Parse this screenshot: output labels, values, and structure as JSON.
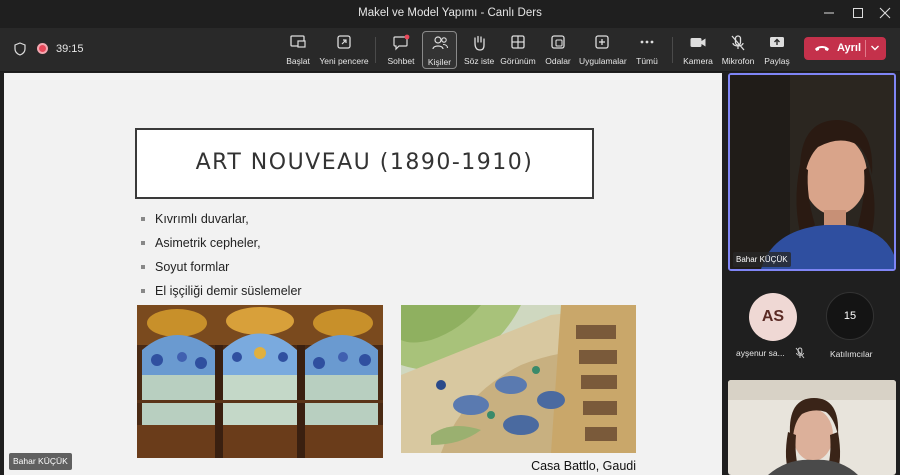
{
  "window": {
    "title": "Makel ve Model Yapımı - Canlı Ders"
  },
  "toolbar": {
    "timer": "39:15",
    "buttons": [
      {
        "label": "Başlat",
        "icon": "share-screen-icon"
      },
      {
        "label": "Yeni pencere",
        "icon": "new-window-icon"
      },
      {
        "label": "Sohbet",
        "icon": "chat-icon"
      },
      {
        "label": "Kişiler",
        "icon": "people-icon"
      },
      {
        "label": "Söz iste",
        "icon": "raise-hand-icon"
      },
      {
        "label": "Görünüm",
        "icon": "view-icon"
      },
      {
        "label": "Odalar",
        "icon": "rooms-icon"
      },
      {
        "label": "Uygulamalar",
        "icon": "apps-icon"
      },
      {
        "label": "Tümü",
        "icon": "more-icon"
      },
      {
        "label": "Kamera",
        "icon": "camera-icon"
      },
      {
        "label": "Mikrofon",
        "icon": "mic-off-icon"
      },
      {
        "label": "Paylaş",
        "icon": "share-icon"
      }
    ],
    "leave_label": "Ayrıl"
  },
  "slide": {
    "title": "ART NOUVEAU (1890-1910)",
    "bullets": [
      "Kıvrımlı duvarlar,",
      "Asimetrik cepheler,",
      "Soyut formlar",
      "El işçiliği demir süslemeler"
    ],
    "caption": "Casa Battlo, Gaudi"
  },
  "presenter_chip": "Bahar KÜÇÜK",
  "participants": {
    "main_video_name": "Bahar KÜÇÜK",
    "avatar_initials": "AS",
    "avatar_name": "ayşenur sa...",
    "count": "15",
    "count_label": "Katılımcılar"
  },
  "colors": {
    "leave": "#c4314b",
    "active_border": "#7f85f5",
    "avatar_bg": "#efd8d4"
  }
}
